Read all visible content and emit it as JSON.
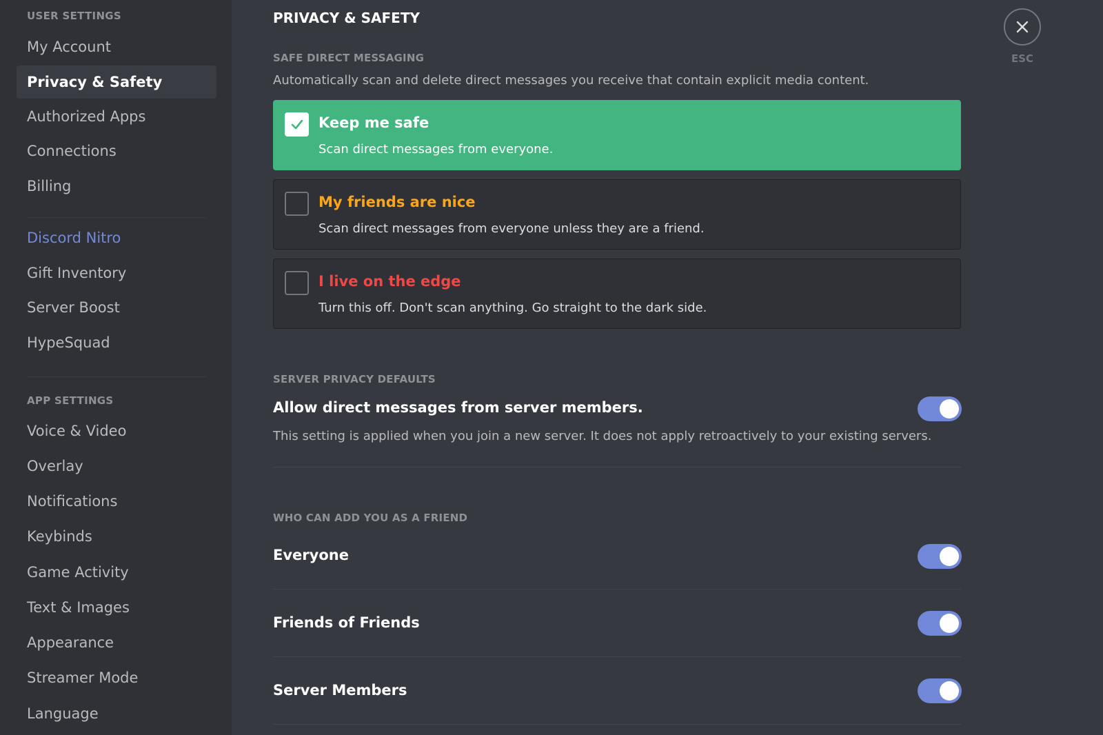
{
  "sidebar": {
    "user_settings_header": "USER SETTINGS",
    "user_items": [
      {
        "label": "My Account"
      },
      {
        "label": "Privacy & Safety",
        "active": true
      },
      {
        "label": "Authorized Apps"
      },
      {
        "label": "Connections"
      },
      {
        "label": "Billing"
      }
    ],
    "nitro_items": [
      {
        "label": "Discord Nitro"
      },
      {
        "label": "Gift Inventory"
      },
      {
        "label": "Server Boost"
      },
      {
        "label": "HypeSquad"
      }
    ],
    "app_settings_header": "APP SETTINGS",
    "app_items": [
      {
        "label": "Voice & Video"
      },
      {
        "label": "Overlay"
      },
      {
        "label": "Notifications"
      },
      {
        "label": "Keybinds"
      },
      {
        "label": "Game Activity"
      },
      {
        "label": "Text & Images"
      },
      {
        "label": "Appearance"
      },
      {
        "label": "Streamer Mode"
      },
      {
        "label": "Language"
      }
    ]
  },
  "main": {
    "title": "PRIVACY & SAFETY",
    "safe_dm": {
      "title": "SAFE DIRECT MESSAGING",
      "description": "Automatically scan and delete direct messages you receive that contain explicit media content.",
      "options": [
        {
          "title": "Keep me safe",
          "description": "Scan direct messages from everyone.",
          "selected": true,
          "color": "#ffffff"
        },
        {
          "title": "My friends are nice",
          "description": "Scan direct messages from everyone unless they are a friend.",
          "selected": false,
          "color": "#faa61a"
        },
        {
          "title": "I live on the edge",
          "description": "Turn this off. Don't scan anything. Go straight to the dark side.",
          "selected": false,
          "color": "#f04747"
        }
      ]
    },
    "server_privacy": {
      "title": "SERVER PRIVACY DEFAULTS",
      "setting_label": "Allow direct messages from server members.",
      "setting_enabled": true,
      "note": "This setting is applied when you join a new server. It does not apply retroactively to your existing servers."
    },
    "friend_requests": {
      "title": "WHO CAN ADD YOU AS A FRIEND",
      "options": [
        {
          "label": "Everyone",
          "enabled": true
        },
        {
          "label": "Friends of Friends",
          "enabled": true
        },
        {
          "label": "Server Members",
          "enabled": true
        }
      ]
    }
  },
  "close": {
    "icon": "close-icon",
    "label": "ESC"
  },
  "colors": {
    "accent": "#7289da",
    "success": "#43b581",
    "warning": "#faa61a",
    "danger": "#f04747"
  }
}
